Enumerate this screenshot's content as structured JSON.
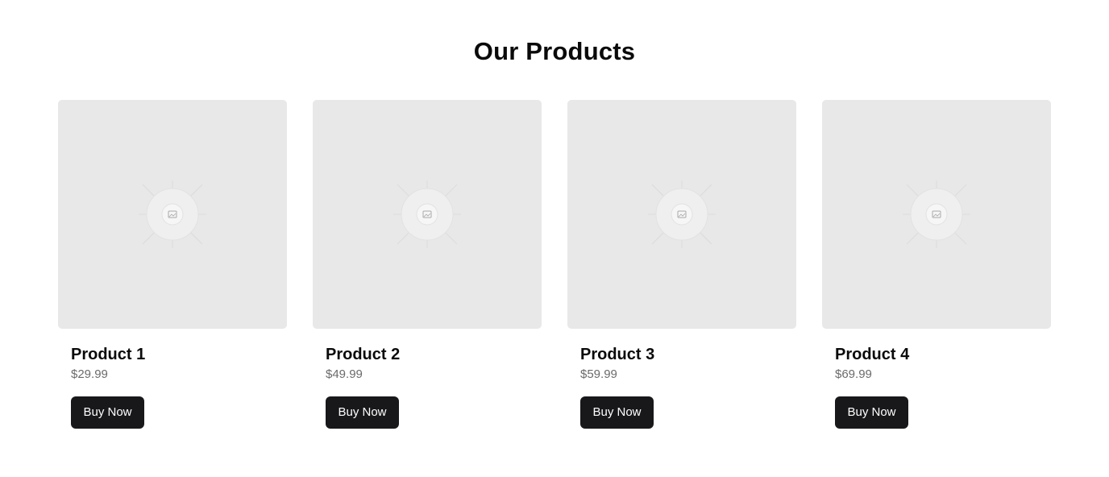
{
  "section": {
    "title": "Our Products"
  },
  "products": [
    {
      "name": "Product 1",
      "price": "$29.99",
      "button_label": "Buy Now"
    },
    {
      "name": "Product 2",
      "price": "$49.99",
      "button_label": "Buy Now"
    },
    {
      "name": "Product 3",
      "price": "$59.99",
      "button_label": "Buy Now"
    },
    {
      "name": "Product 4",
      "price": "$69.99",
      "button_label": "Buy Now"
    }
  ],
  "colors": {
    "background": "#ffffff",
    "placeholder": "#e8e8e8",
    "button": "#18181b",
    "price_text": "#6b6b6b"
  },
  "icons": {
    "placeholder": "image-placeholder-icon"
  }
}
